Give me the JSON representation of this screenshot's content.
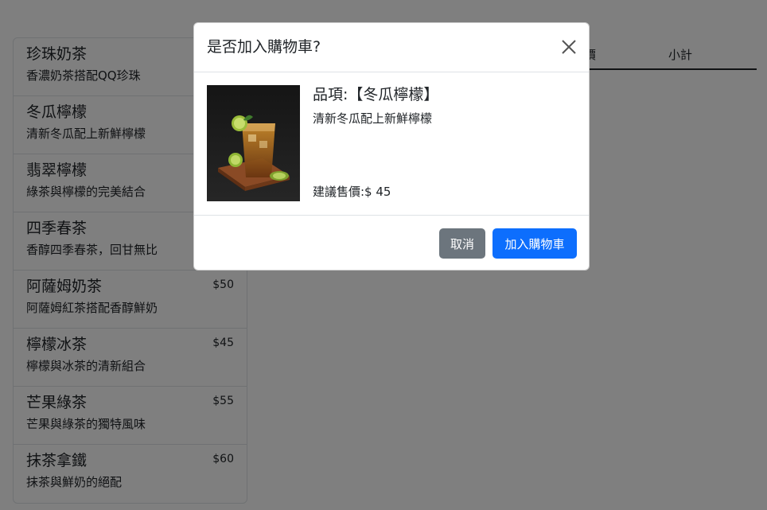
{
  "menu": {
    "items": [
      {
        "name": "珍珠奶茶",
        "desc": "香濃奶茶搭配QQ珍珠",
        "price": ""
      },
      {
        "name": "冬瓜檸檬",
        "desc": "清新冬瓜配上新鮮檸檬",
        "price": ""
      },
      {
        "name": "翡翠檸檬",
        "desc": "綠茶與檸檬的完美結合",
        "price": ""
      },
      {
        "name": "四季春茶",
        "desc": "香醇四季春茶，回甘無比",
        "price": ""
      },
      {
        "name": "阿薩姆奶茶",
        "desc": "阿薩姆紅茶搭配香醇鮮奶",
        "price": "$50"
      },
      {
        "name": "檸檬冰茶",
        "desc": "檸檬與冰茶的清新組合",
        "price": "$45"
      },
      {
        "name": "芒果綠茶",
        "desc": "芒果與綠茶的獨特風味",
        "price": "$55"
      },
      {
        "name": "抹茶拿鐵",
        "desc": "抹茶與鮮奶的絕配",
        "price": "$60"
      }
    ]
  },
  "cart": {
    "headers": {
      "price": "價",
      "subtotal": "小計"
    }
  },
  "modal": {
    "title": "是否加入購物車?",
    "item_label": "品項:【冬瓜檸檬】",
    "item_desc": "清新冬瓜配上新鮮檸檬",
    "price_label": "建議售價:$ 45",
    "cancel_label": "取消",
    "add_label": "加入購物車",
    "close_icon": "close-icon"
  },
  "colors": {
    "primary": "#0d6efd",
    "secondary": "#6c757d",
    "backdrop": "rgba(0,0,0,0.5)"
  }
}
